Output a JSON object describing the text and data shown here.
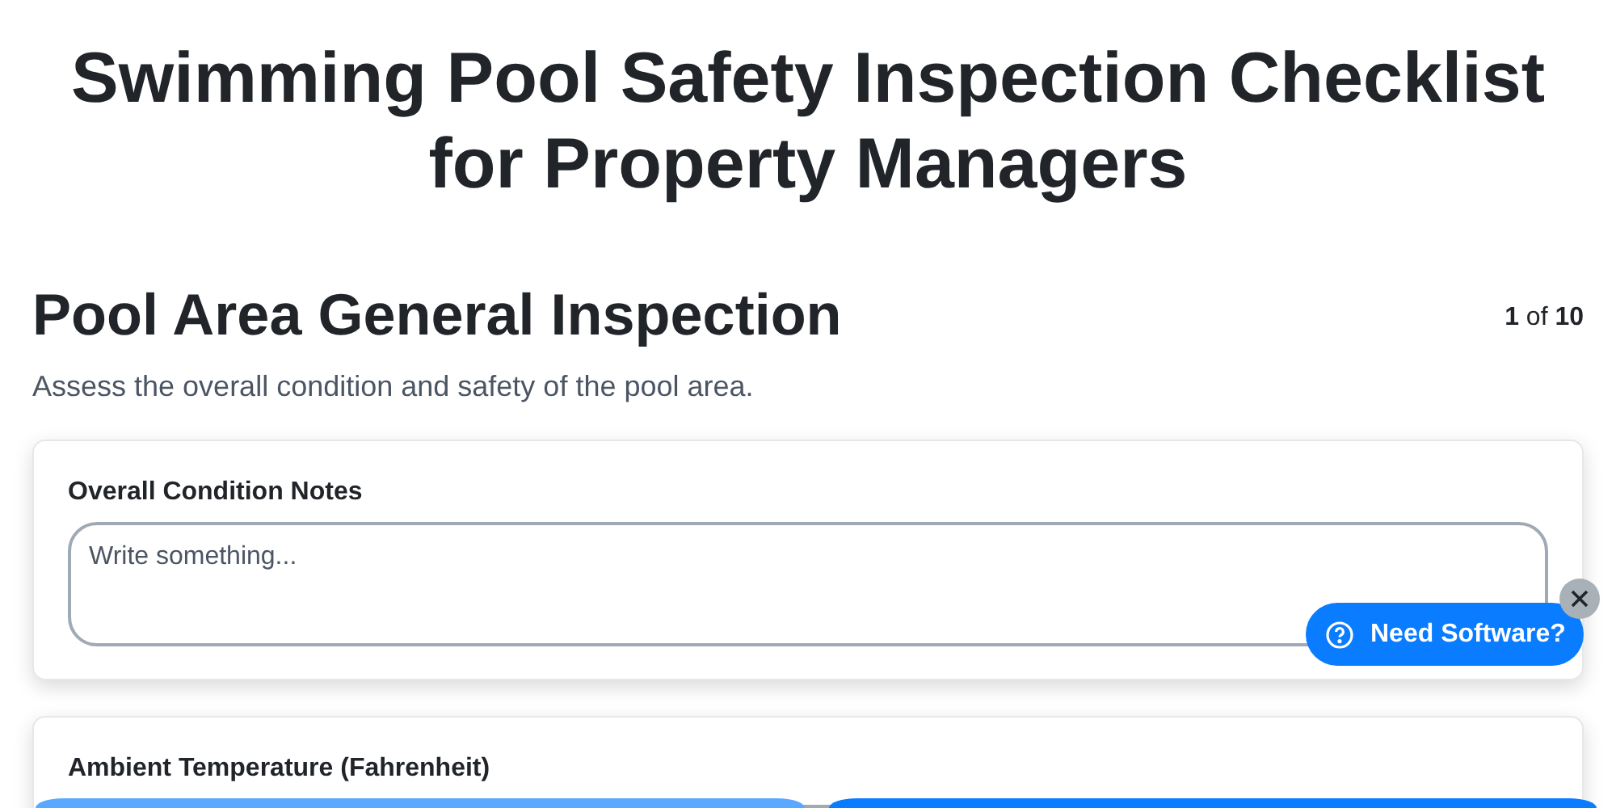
{
  "title": "Swimming Pool Safety Inspection Checklist for Property Managers",
  "section": {
    "heading": "Pool Area General Inspection",
    "progress": "**1** of **10**",
    "description": "Assess the overall condition and safety of the pool area."
  },
  "fields": [
    {
      "kind": "textarea",
      "label": "Overall Condition Notes",
      "placeholder": "Write something..."
    },
    {
      "kind": "input",
      "label": "Ambient Temperature (Fahrenheit)"
    }
  ],
  "help_button": {
    "label": "Need Software?"
  },
  "footer_buttons": [
    {
      "kind": "secondary"
    },
    {
      "kind": "primary"
    }
  ]
}
